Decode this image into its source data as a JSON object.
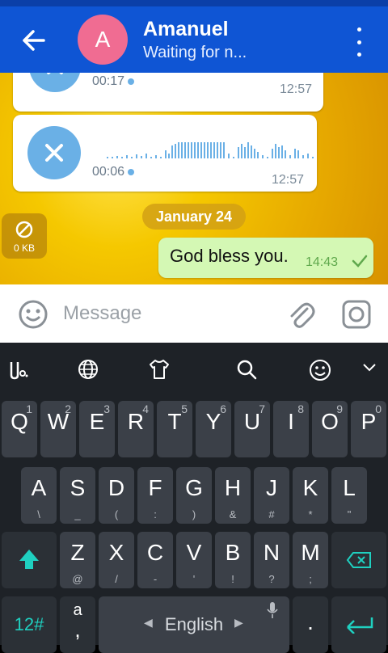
{
  "header": {
    "avatar_letter": "A",
    "name": "Amanuel",
    "status": "Waiting for n..."
  },
  "messages": {
    "voice1": {
      "duration": "00:17",
      "time": "12:57"
    },
    "voice2": {
      "duration": "00:06",
      "time": "12:57"
    },
    "date_separator": "January 24",
    "file_size": "0 KB",
    "outgoing": {
      "text": "God bless you.",
      "time": "14:43"
    }
  },
  "input": {
    "placeholder": "Message"
  },
  "keyboard": {
    "row1": [
      {
        "k": "Q",
        "n": "1"
      },
      {
        "k": "W",
        "n": "2"
      },
      {
        "k": "E",
        "n": "3"
      },
      {
        "k": "R",
        "n": "4"
      },
      {
        "k": "T",
        "n": "5"
      },
      {
        "k": "Y",
        "n": "6"
      },
      {
        "k": "U",
        "n": "7"
      },
      {
        "k": "I",
        "n": "8"
      },
      {
        "k": "O",
        "n": "9"
      },
      {
        "k": "P",
        "n": "0"
      }
    ],
    "row2": [
      {
        "k": "A",
        "s": "\\"
      },
      {
        "k": "S",
        "s": "_"
      },
      {
        "k": "D",
        "s": "("
      },
      {
        "k": "F",
        "s": ":"
      },
      {
        "k": "G",
        "s": ")"
      },
      {
        "k": "H",
        "s": "&"
      },
      {
        "k": "J",
        "s": "#"
      },
      {
        "k": "K",
        "s": "*"
      },
      {
        "k": "L",
        "s": "\""
      }
    ],
    "row3": [
      {
        "k": "Z",
        "s": "@"
      },
      {
        "k": "X",
        "s": "/"
      },
      {
        "k": "C",
        "s": "-"
      },
      {
        "k": "V",
        "s": "'"
      },
      {
        "k": "B",
        "s": "!"
      },
      {
        "k": "N",
        "s": "?"
      },
      {
        "k": "M",
        "s": ";"
      }
    ],
    "symbols_label": "12#",
    "language_label": "English",
    "period": ".",
    "comma_top": "a",
    "comma": ","
  },
  "colors": {
    "appbar": "#0f55d4",
    "accent": "#1fd0c0",
    "outgoing_bubble": "#d4f8b4"
  }
}
